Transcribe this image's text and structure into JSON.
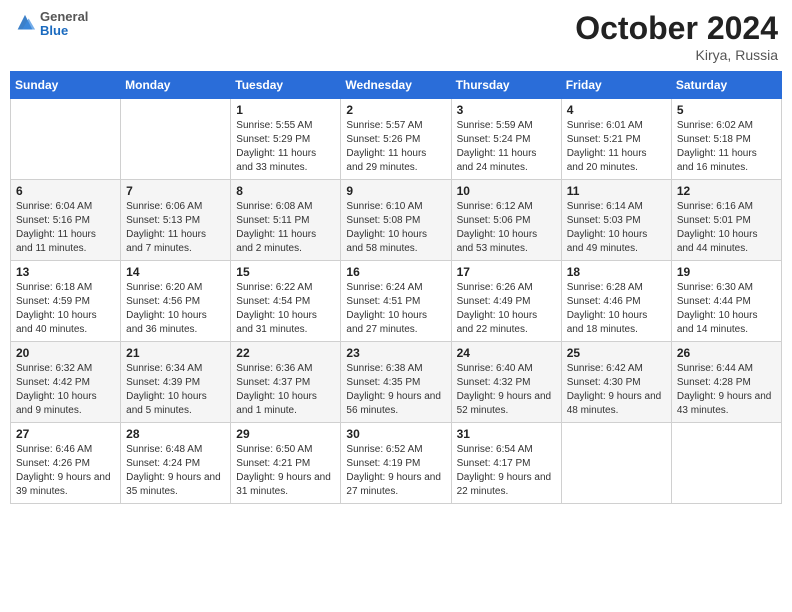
{
  "header": {
    "logo_general": "General",
    "logo_blue": "Blue",
    "month_title": "October 2024",
    "location": "Kirya, Russia"
  },
  "days_of_week": [
    "Sunday",
    "Monday",
    "Tuesday",
    "Wednesday",
    "Thursday",
    "Friday",
    "Saturday"
  ],
  "weeks": [
    [
      {
        "day": "",
        "sunrise": "",
        "sunset": "",
        "daylight": ""
      },
      {
        "day": "",
        "sunrise": "",
        "sunset": "",
        "daylight": ""
      },
      {
        "day": "1",
        "sunrise": "Sunrise: 5:55 AM",
        "sunset": "Sunset: 5:29 PM",
        "daylight": "Daylight: 11 hours and 33 minutes."
      },
      {
        "day": "2",
        "sunrise": "Sunrise: 5:57 AM",
        "sunset": "Sunset: 5:26 PM",
        "daylight": "Daylight: 11 hours and 29 minutes."
      },
      {
        "day": "3",
        "sunrise": "Sunrise: 5:59 AM",
        "sunset": "Sunset: 5:24 PM",
        "daylight": "Daylight: 11 hours and 24 minutes."
      },
      {
        "day": "4",
        "sunrise": "Sunrise: 6:01 AM",
        "sunset": "Sunset: 5:21 PM",
        "daylight": "Daylight: 11 hours and 20 minutes."
      },
      {
        "day": "5",
        "sunrise": "Sunrise: 6:02 AM",
        "sunset": "Sunset: 5:18 PM",
        "daylight": "Daylight: 11 hours and 16 minutes."
      }
    ],
    [
      {
        "day": "6",
        "sunrise": "Sunrise: 6:04 AM",
        "sunset": "Sunset: 5:16 PM",
        "daylight": "Daylight: 11 hours and 11 minutes."
      },
      {
        "day": "7",
        "sunrise": "Sunrise: 6:06 AM",
        "sunset": "Sunset: 5:13 PM",
        "daylight": "Daylight: 11 hours and 7 minutes."
      },
      {
        "day": "8",
        "sunrise": "Sunrise: 6:08 AM",
        "sunset": "Sunset: 5:11 PM",
        "daylight": "Daylight: 11 hours and 2 minutes."
      },
      {
        "day": "9",
        "sunrise": "Sunrise: 6:10 AM",
        "sunset": "Sunset: 5:08 PM",
        "daylight": "Daylight: 10 hours and 58 minutes."
      },
      {
        "day": "10",
        "sunrise": "Sunrise: 6:12 AM",
        "sunset": "Sunset: 5:06 PM",
        "daylight": "Daylight: 10 hours and 53 minutes."
      },
      {
        "day": "11",
        "sunrise": "Sunrise: 6:14 AM",
        "sunset": "Sunset: 5:03 PM",
        "daylight": "Daylight: 10 hours and 49 minutes."
      },
      {
        "day": "12",
        "sunrise": "Sunrise: 6:16 AM",
        "sunset": "Sunset: 5:01 PM",
        "daylight": "Daylight: 10 hours and 44 minutes."
      }
    ],
    [
      {
        "day": "13",
        "sunrise": "Sunrise: 6:18 AM",
        "sunset": "Sunset: 4:59 PM",
        "daylight": "Daylight: 10 hours and 40 minutes."
      },
      {
        "day": "14",
        "sunrise": "Sunrise: 6:20 AM",
        "sunset": "Sunset: 4:56 PM",
        "daylight": "Daylight: 10 hours and 36 minutes."
      },
      {
        "day": "15",
        "sunrise": "Sunrise: 6:22 AM",
        "sunset": "Sunset: 4:54 PM",
        "daylight": "Daylight: 10 hours and 31 minutes."
      },
      {
        "day": "16",
        "sunrise": "Sunrise: 6:24 AM",
        "sunset": "Sunset: 4:51 PM",
        "daylight": "Daylight: 10 hours and 27 minutes."
      },
      {
        "day": "17",
        "sunrise": "Sunrise: 6:26 AM",
        "sunset": "Sunset: 4:49 PM",
        "daylight": "Daylight: 10 hours and 22 minutes."
      },
      {
        "day": "18",
        "sunrise": "Sunrise: 6:28 AM",
        "sunset": "Sunset: 4:46 PM",
        "daylight": "Daylight: 10 hours and 18 minutes."
      },
      {
        "day": "19",
        "sunrise": "Sunrise: 6:30 AM",
        "sunset": "Sunset: 4:44 PM",
        "daylight": "Daylight: 10 hours and 14 minutes."
      }
    ],
    [
      {
        "day": "20",
        "sunrise": "Sunrise: 6:32 AM",
        "sunset": "Sunset: 4:42 PM",
        "daylight": "Daylight: 10 hours and 9 minutes."
      },
      {
        "day": "21",
        "sunrise": "Sunrise: 6:34 AM",
        "sunset": "Sunset: 4:39 PM",
        "daylight": "Daylight: 10 hours and 5 minutes."
      },
      {
        "day": "22",
        "sunrise": "Sunrise: 6:36 AM",
        "sunset": "Sunset: 4:37 PM",
        "daylight": "Daylight: 10 hours and 1 minute."
      },
      {
        "day": "23",
        "sunrise": "Sunrise: 6:38 AM",
        "sunset": "Sunset: 4:35 PM",
        "daylight": "Daylight: 9 hours and 56 minutes."
      },
      {
        "day": "24",
        "sunrise": "Sunrise: 6:40 AM",
        "sunset": "Sunset: 4:32 PM",
        "daylight": "Daylight: 9 hours and 52 minutes."
      },
      {
        "day": "25",
        "sunrise": "Sunrise: 6:42 AM",
        "sunset": "Sunset: 4:30 PM",
        "daylight": "Daylight: 9 hours and 48 minutes."
      },
      {
        "day": "26",
        "sunrise": "Sunrise: 6:44 AM",
        "sunset": "Sunset: 4:28 PM",
        "daylight": "Daylight: 9 hours and 43 minutes."
      }
    ],
    [
      {
        "day": "27",
        "sunrise": "Sunrise: 6:46 AM",
        "sunset": "Sunset: 4:26 PM",
        "daylight": "Daylight: 9 hours and 39 minutes."
      },
      {
        "day": "28",
        "sunrise": "Sunrise: 6:48 AM",
        "sunset": "Sunset: 4:24 PM",
        "daylight": "Daylight: 9 hours and 35 minutes."
      },
      {
        "day": "29",
        "sunrise": "Sunrise: 6:50 AM",
        "sunset": "Sunset: 4:21 PM",
        "daylight": "Daylight: 9 hours and 31 minutes."
      },
      {
        "day": "30",
        "sunrise": "Sunrise: 6:52 AM",
        "sunset": "Sunset: 4:19 PM",
        "daylight": "Daylight: 9 hours and 27 minutes."
      },
      {
        "day": "31",
        "sunrise": "Sunrise: 6:54 AM",
        "sunset": "Sunset: 4:17 PM",
        "daylight": "Daylight: 9 hours and 22 minutes."
      },
      {
        "day": "",
        "sunrise": "",
        "sunset": "",
        "daylight": ""
      },
      {
        "day": "",
        "sunrise": "",
        "sunset": "",
        "daylight": ""
      }
    ]
  ]
}
